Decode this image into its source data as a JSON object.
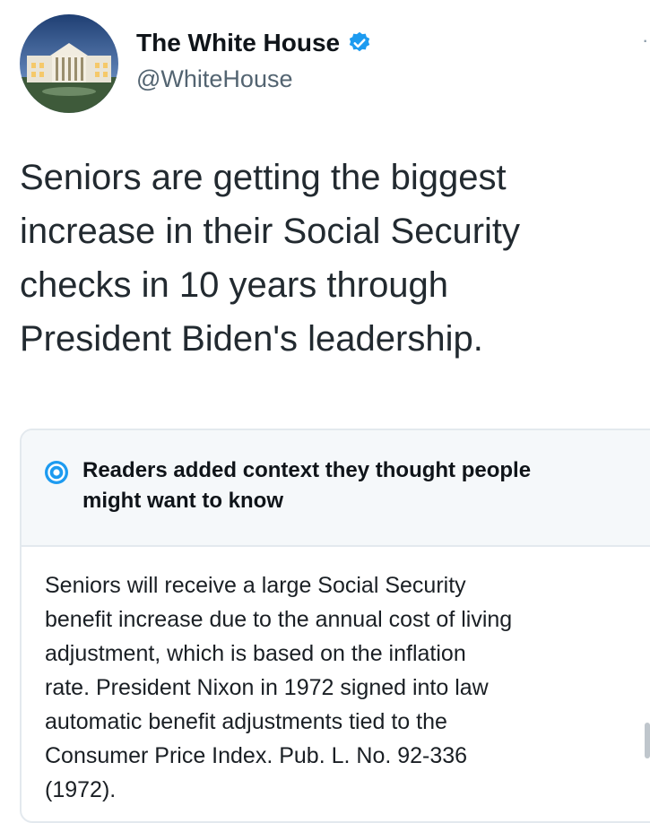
{
  "author": {
    "display_name": "The White House",
    "handle": "@WhiteHouse",
    "verified": true,
    "verified_color": "#1d9bf0"
  },
  "tweet": {
    "lines": [
      "Seniors are getting the biggest",
      "increase in their Social Security",
      "checks in 10 years through",
      "President Biden's leadership."
    ]
  },
  "context_note": {
    "title_lines": [
      "Readers added context they thought people",
      "might want to know"
    ],
    "body_lines": [
      "Seniors will receive a large Social Security",
      "benefit increase due to the annual cost of living",
      "adjustment, which is based on the inflation",
      "rate. President Nixon in 1972 signed into law",
      "automatic benefit adjustments tied to the",
      "Consumer Price Index. Pub. L. No. 92-336",
      "(1972)."
    ],
    "icon_color": "#1d9bf0"
  },
  "icons": {
    "avatar": "white-house-photo",
    "verified": "verified-badge-icon",
    "context": "community-notes-icon",
    "more": "more-options-icon"
  }
}
